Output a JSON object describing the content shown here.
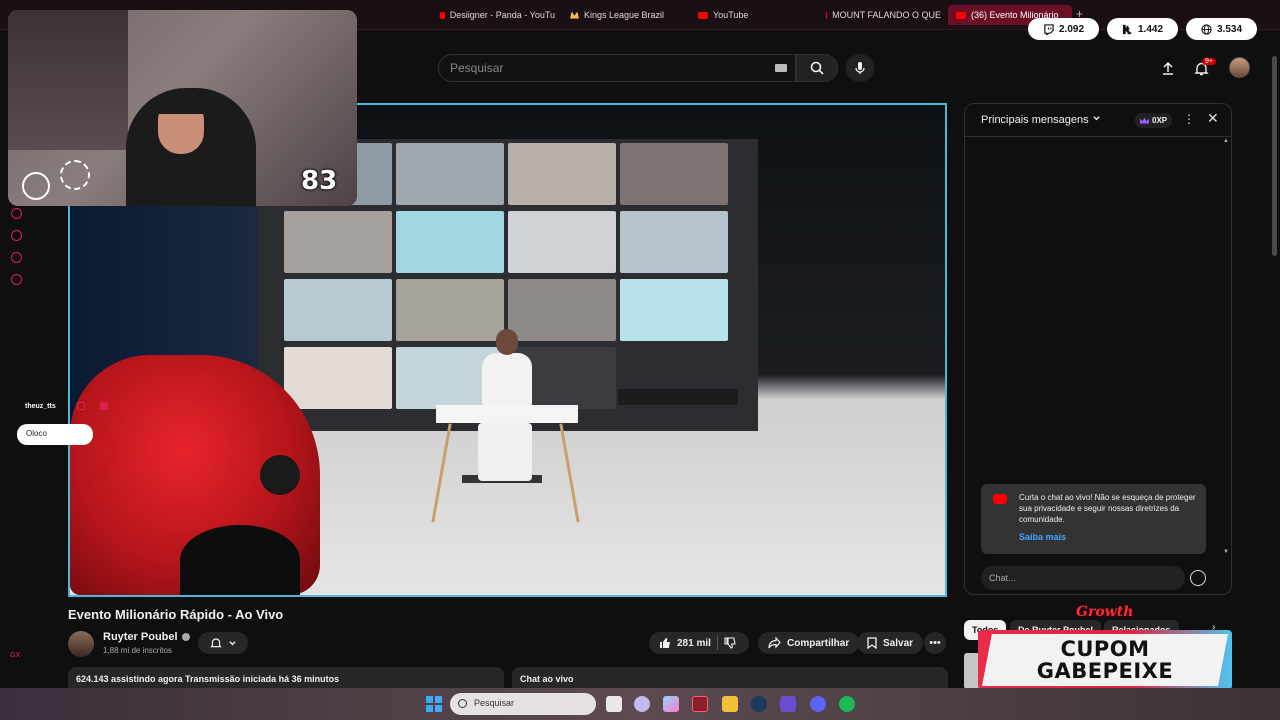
{
  "browser": {
    "tabs": [
      {
        "label": "Desiigner - Panda - YouTu",
        "icon": "youtube-icon"
      },
      {
        "label": "Kings League Brazil",
        "icon": "kings-league-icon"
      },
      {
        "label": "YouTube",
        "icon": "youtube-icon"
      },
      {
        "label": "MOUNT FALANDO O QUE",
        "icon": "youtube-icon"
      },
      {
        "label": "(36) Evento Milionário",
        "icon": "youtube-icon",
        "active": true
      }
    ],
    "new_tab": "+"
  },
  "stats": {
    "twitch": "2.092",
    "kick": "1.442",
    "web": "3.534"
  },
  "header": {
    "search_placeholder": "Pesquisar",
    "notif_badge": "9+"
  },
  "webcam": {
    "counter": "83"
  },
  "floating_chat": {
    "user": "theuz_tts",
    "message": "Oloco"
  },
  "video": {
    "title": "Evento Milionário Rápido - Ao Vivo",
    "channel": "Ruyter Poubel",
    "subscribers": "1,88 mi de inscritos",
    "likes": "281 mil",
    "share": "Compartilhar",
    "save": "Salvar",
    "more": "•••",
    "desc_line": "624.143 assistindo agora  Transmissão iniciada há 36 minutos",
    "chat_live": "Chat ao vivo"
  },
  "chat": {
    "title": "Principais mensagens",
    "xp": "0XP",
    "notice": "Curta o chat ao vivo! Não se esqueça de proteger sua privacidade e seguir nossas diretrizes da comunidade.",
    "notice_link": "Saiba mais",
    "input_placeholder": "Chat..."
  },
  "related_chips": [
    "Todos",
    "De Ruyter Poubel",
    "Relacionados"
  ],
  "promo": {
    "logo": "Growth",
    "line1": "CUPOM",
    "line2": "GABEPEIXE"
  },
  "taskbar": {
    "search": "Pesquisar"
  },
  "colors": {
    "accent": "#e0204d",
    "player_border": "#4fb7d8",
    "link": "#3ea6ff",
    "youtube_red": "#ff0000"
  }
}
